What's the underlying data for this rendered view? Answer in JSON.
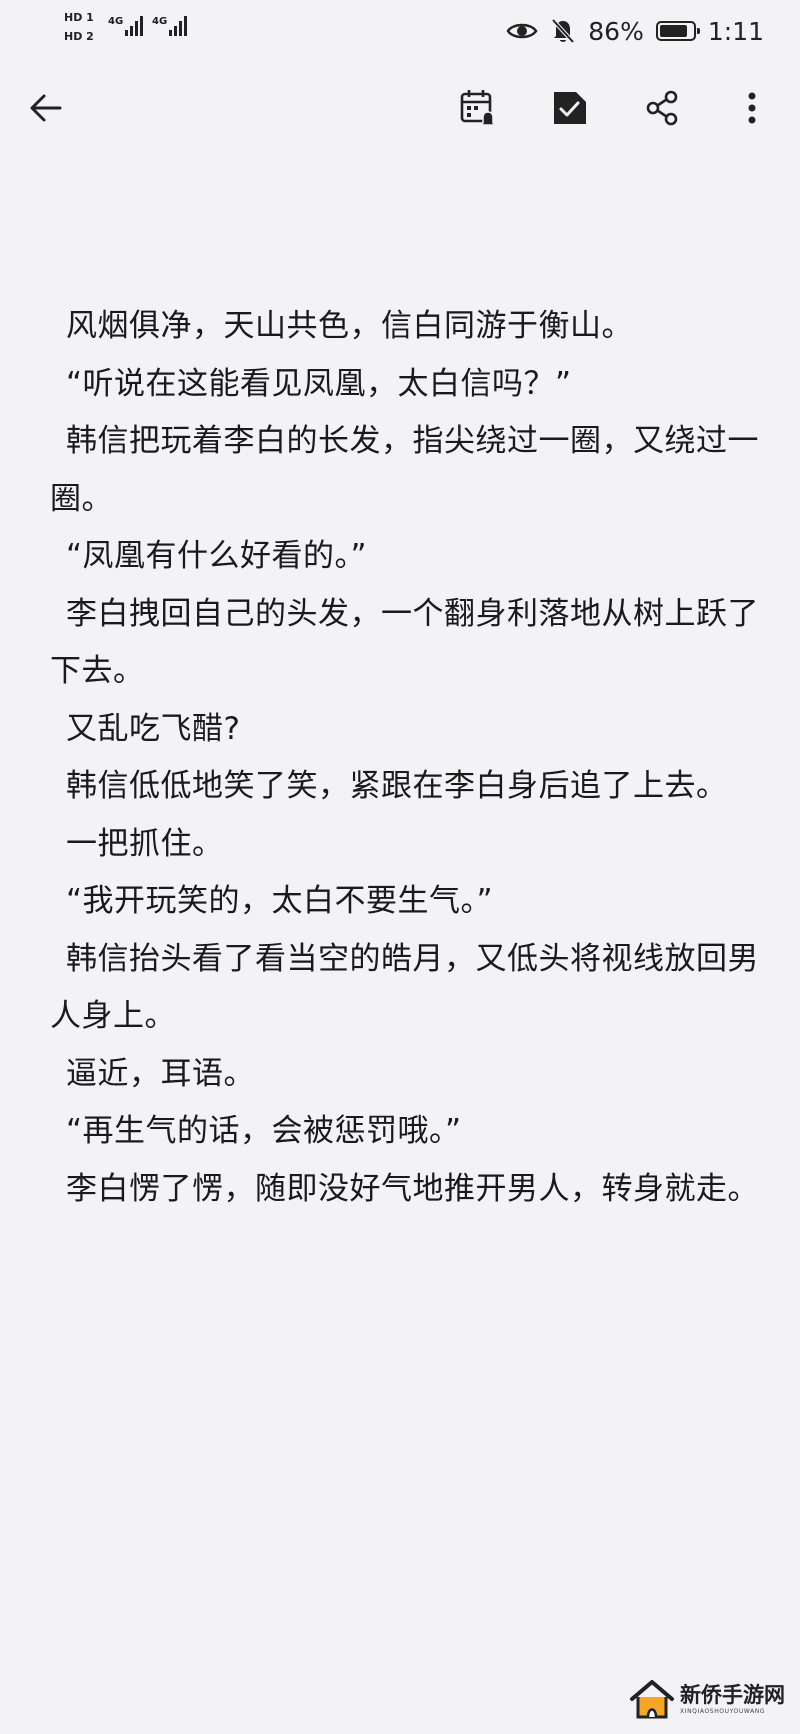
{
  "status_bar": {
    "sim1": "HD 1",
    "sim2": "HD 2",
    "network1": "4G",
    "network2": "4G",
    "battery_percent": "86%",
    "battery_level": 0.86,
    "time": "1:11",
    "icons": [
      "eye-icon",
      "bell-off-icon",
      "battery-icon"
    ]
  },
  "toolbar": {
    "icons": [
      "back-arrow-icon",
      "calendar-reminder-icon",
      "checkbox-icon",
      "share-icon",
      "more-icon"
    ]
  },
  "content": {
    "paragraphs": [
      "风烟俱净，天山共色，信白同游于衡山。",
      "“听说在这能看见凤凰，太白信吗？”",
      "韩信把玩着李白的长发，指尖绕过一圈，又绕过一圈。",
      "“凤凰有什么好看的。”",
      "李白拽回自己的头发，一个翻身利落地从树上跃了下去。",
      "又乱吃飞醋?",
      "韩信低低地笑了笑，紧跟在李白身后追了上去。",
      "一把抓住。",
      "“我开玩笑的，太白不要生气。”",
      "韩信抬头看了看当空的皓月，又低头将视线放回男人身上。",
      "逼近，耳语。",
      "“再生气的话，会被惩罚哦。”",
      "李白愣了愣，随即没好气地推开男人，转身就走。"
    ]
  },
  "watermark": {
    "name": "新侨手游网",
    "sub": "XINQIAOSHOUYOUWANG"
  }
}
